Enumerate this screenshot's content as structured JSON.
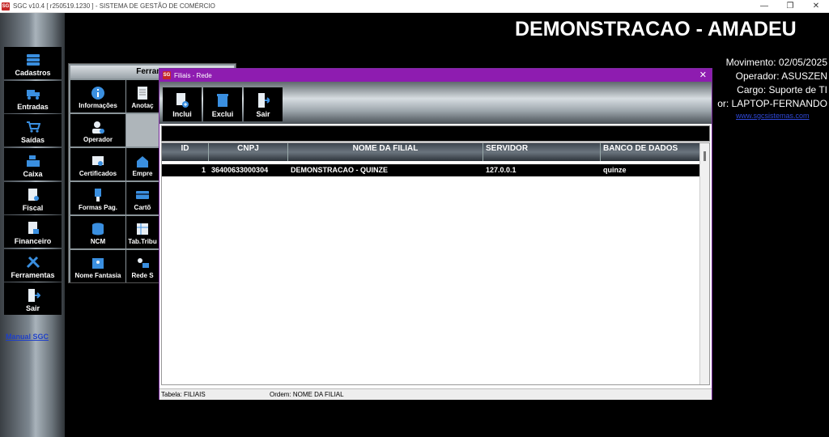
{
  "window": {
    "title": "SGC v10.4 [ r250519.1230 ] - SISTEMA DE GESTÃO DE COMÉRCIO",
    "app_icon": "SG"
  },
  "header": {
    "company": "DEMONSTRACAO - AMADEU",
    "movimento": "Movimento: 02/05/2025",
    "operador": "Operador: ASUSZEN",
    "cargo": "Cargo: Suporte de TI",
    "computador": "or: LAPTOP-FERNANDO",
    "site": "www.sgcsistemas.com"
  },
  "sidebar": {
    "items": [
      {
        "label": "Cadastros",
        "icon": "database-icon"
      },
      {
        "label": "Entradas",
        "icon": "truck-icon"
      },
      {
        "label": "Saídas",
        "icon": "cart-icon"
      },
      {
        "label": "Caixa",
        "icon": "cash-register-icon"
      },
      {
        "label": "Fiscal",
        "icon": "fiscal-document-icon"
      },
      {
        "label": "Financeiro",
        "icon": "finance-document-icon"
      },
      {
        "label": "Ferramentas",
        "icon": "tools-icon"
      },
      {
        "label": "Sair",
        "icon": "exit-door-icon"
      }
    ],
    "manual_link": "Manual SGC"
  },
  "tools_panel": {
    "title": "Ferrame",
    "items": [
      {
        "label": "Informações",
        "icon": "info-icon"
      },
      {
        "label": "Anotaç",
        "icon": "notes-icon"
      },
      {
        "label": "Operador",
        "icon": "operator-icon"
      },
      {
        "label": "Certificados",
        "icon": "certificate-icon"
      },
      {
        "label": "Empre",
        "icon": "company-icon"
      },
      {
        "label": "Formas Pag.",
        "icon": "payment-icon"
      },
      {
        "label": "Cartõ",
        "icon": "card-icon"
      },
      {
        "label": "NCM",
        "icon": "ncm-database-icon"
      },
      {
        "label": "Tab.Tribu",
        "icon": "tax-table-icon"
      },
      {
        "label": "Nome Fantasia",
        "icon": "trade-name-icon"
      },
      {
        "label": "Rede S",
        "icon": "network-icon"
      }
    ]
  },
  "dialog": {
    "title": "Filiais - Rede",
    "close": "✕",
    "toolbar": [
      {
        "label": "Inclui",
        "icon": "add-document-icon"
      },
      {
        "label": "Exclui",
        "icon": "delete-icon"
      },
      {
        "label": "Sair",
        "icon": "exit-door-icon"
      }
    ],
    "grid": {
      "columns": [
        "ID",
        "CNPJ",
        "NOME DA FILIAL",
        "SERVIDOR",
        "BANCO DE DADOS"
      ],
      "rows": [
        {
          "id": "1",
          "cnpj": "36400633000304",
          "nome": "DEMONSTRACAO - QUINZE",
          "servidor": "127.0.0.1",
          "banco": "quinze"
        }
      ]
    },
    "status": {
      "tabela": "Tabela: FILIAIS",
      "ordem": "Ordem: NOME DA FILIAL"
    }
  },
  "colors": {
    "dialog_title": "#8e1cb0",
    "link": "#1e3fc8",
    "icon_blue": "#3a8fe0"
  }
}
